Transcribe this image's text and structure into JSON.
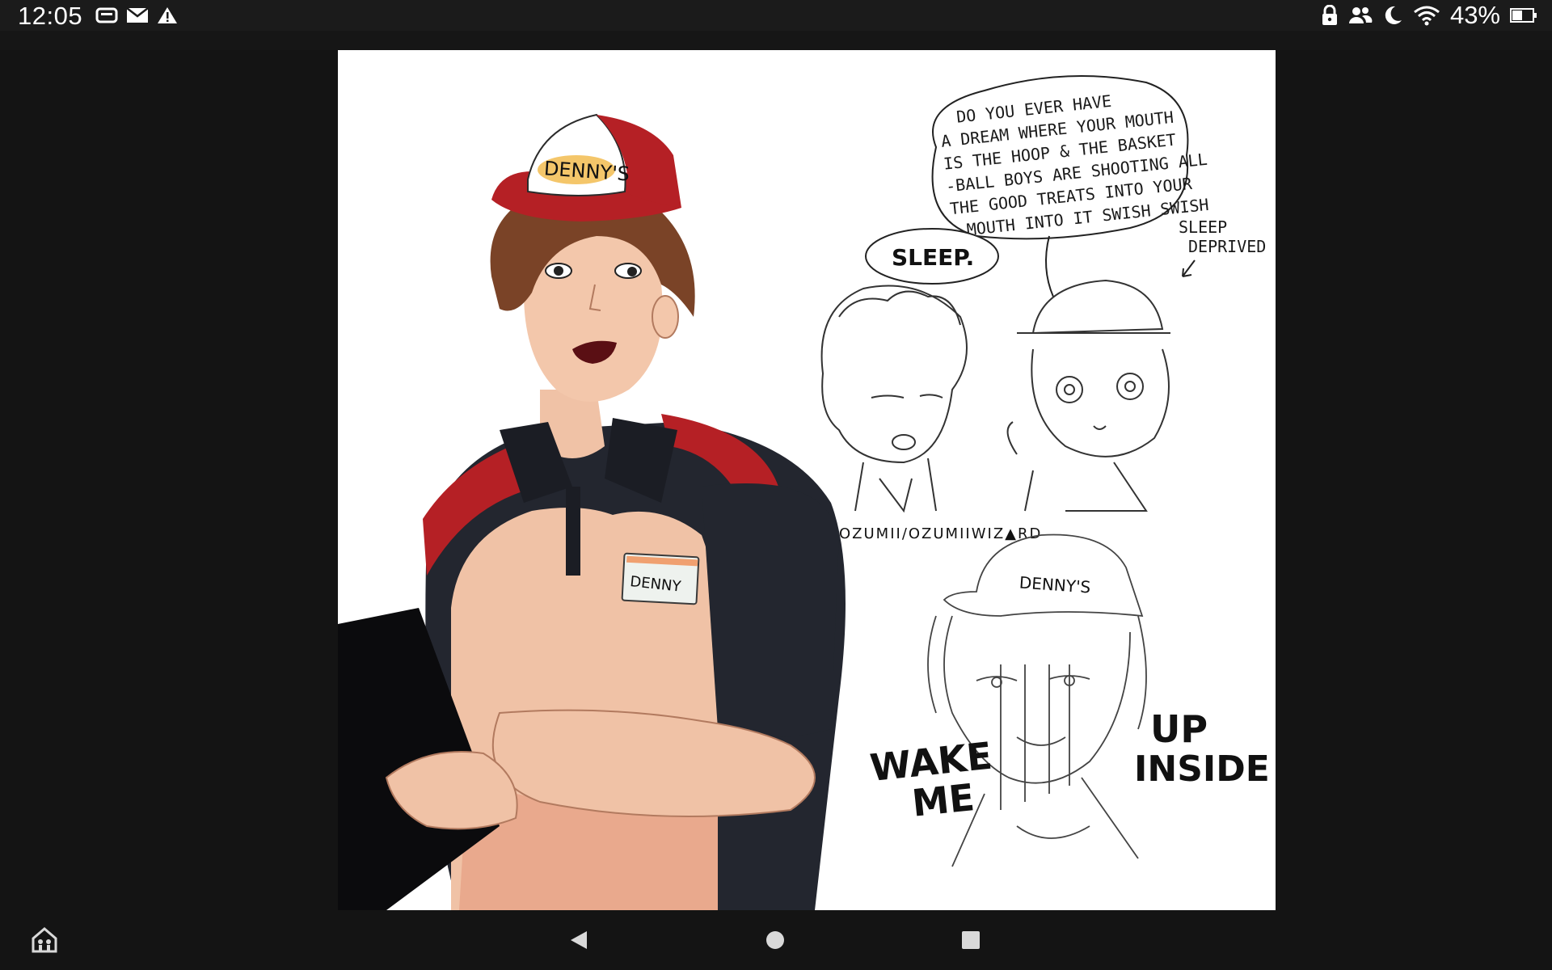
{
  "status_bar": {
    "time": "12:05",
    "battery": "43%",
    "left_icons": [
      "gamepad-icon",
      "mail-icon",
      "warning-icon"
    ],
    "right_icons": [
      "lock-icon",
      "people-icon",
      "moon-icon",
      "wifi-icon",
      "battery-icon"
    ]
  },
  "artwork": {
    "hat_logo": "DENNY'S",
    "name_tag": "DENNY",
    "thought_bubble": [
      "DO YOU EVER HAVE",
      "A DREAM WHERE YOUR MOUTH",
      "IS THE HOOP & THE BASKET",
      "-BALL BOYS ARE SHOOTING ALL",
      "THE GOOD TREATS INTO YOUR",
      "MOUTH INTO IT SWISH SWISH"
    ],
    "speech_bubble": "SLEEP.",
    "sleep_note": [
      "SLEEP",
      "DEPRIVED"
    ],
    "credit": "OZUMII/OZUMIIWIZ▲RD",
    "wake_left": [
      "WAKE",
      "ME"
    ],
    "wake_right": [
      "UP",
      "INSIDE"
    ],
    "sketch_hat_logo": "DENNY'S"
  },
  "nav_bar": {
    "buttons": [
      "accessibility-icon",
      "back-icon",
      "home-icon",
      "recents-icon"
    ]
  },
  "colors": {
    "background": "#141414",
    "cap_red": "#b52025",
    "shirt_navy": "#23262f",
    "skin": "#f0c2a6"
  }
}
